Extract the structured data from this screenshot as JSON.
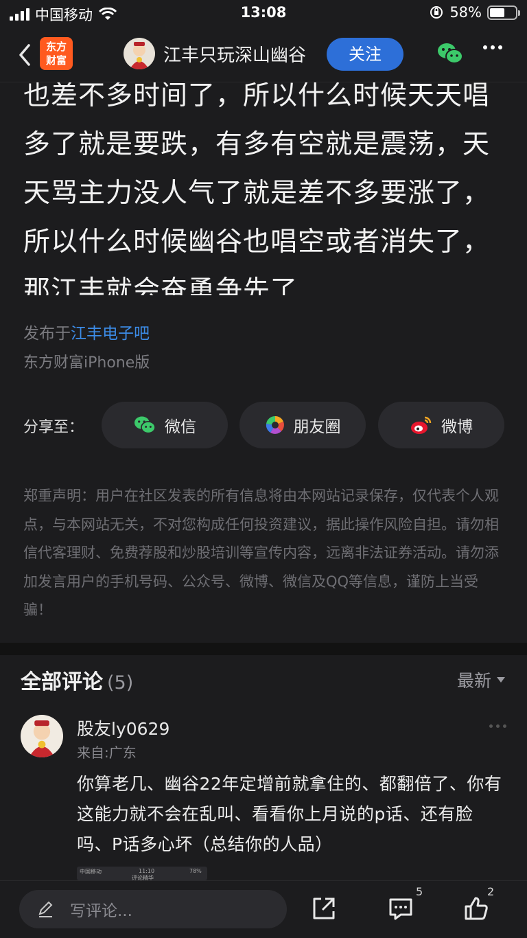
{
  "status_bar": {
    "carrier": "中国移动",
    "time": "13:08",
    "battery_percent": "58%",
    "battery_level": 0.58
  },
  "nav": {
    "logo_line1": "东方",
    "logo_line2": "财富",
    "author_name": "江丰只玩深山幽谷",
    "follow_label": "关注",
    "icons": [
      "back-icon",
      "wechat-icon",
      "more-icon"
    ]
  },
  "post": {
    "text": "也差不多时间了，所以什么时候天天唱多了就是要跌，有多有空就是震荡，天天骂主力没人气了就是差不多要涨了，所以什么时候幽谷也唱空或者消失了，那江丰就会奋勇争先了",
    "published_prefix": "发布于",
    "published_board": "江丰电子吧",
    "client": "东方财富iPhone版"
  },
  "share": {
    "label": "分享至：",
    "wechat": "微信",
    "moments": "朋友圈",
    "weibo": "微博"
  },
  "disclaimer": "郑重声明：用户在社区发表的所有信息将由本网站记录保存，仅代表个人观点，与本网站无关，不对您构成任何投资建议，据此操作风险自担。请勿相信代客理财、免费荐股和炒股培训等宣传内容，远离非法证券活动。请勿添加发言用户的手机号码、公众号、微博、微信及QQ等信息，谨防上当受骗！",
  "comments": {
    "title": "全部评论",
    "count": "(5)",
    "sort_label": "最新",
    "items": [
      {
        "user": "股友ly0629",
        "location": "来自:广东",
        "text": "你算老几、幽谷22年定增前就拿住的、都翻倍了、你有这能力就不会在乱叫、看看你上月说的p话、还有脸吗、P话多心坏（总结你的人品）",
        "thumb_carrier": "中国移动",
        "thumb_time": "11:10",
        "thumb_battery": "78%",
        "thumb_title": "评论精华"
      }
    ]
  },
  "bottom_bar": {
    "placeholder": "写评论...",
    "comment_count": "5",
    "like_count": "2"
  },
  "colors": {
    "background": "#1c1c1e",
    "accent_blue": "#2d6fd8",
    "link_blue": "#3c8ce7",
    "brand_orange": "#ff5a1f"
  }
}
